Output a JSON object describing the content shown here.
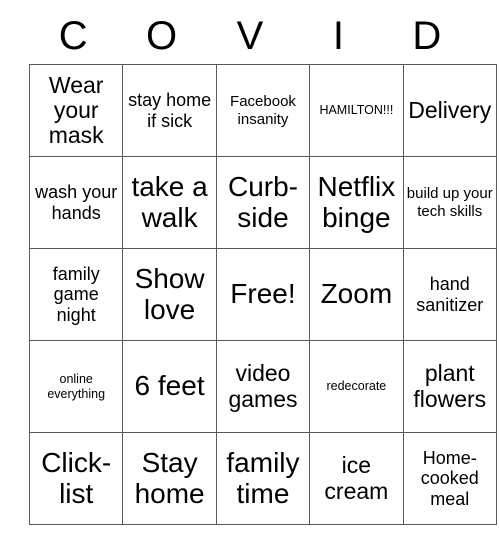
{
  "card": {
    "header_letters": [
      "C",
      "O",
      "V",
      "I",
      "D"
    ],
    "rows": [
      [
        {
          "text": "Wear your mask",
          "size": "l"
        },
        {
          "text": "stay home if sick",
          "size": "m"
        },
        {
          "text": "Facebook insanity",
          "size": "s"
        },
        {
          "text": "HAMILTON!!!",
          "size": "xs"
        },
        {
          "text": "Delivery",
          "size": "l"
        }
      ],
      [
        {
          "text": "wash your hands",
          "size": "m"
        },
        {
          "text": "take a walk",
          "size": "xl"
        },
        {
          "text": "Curb-side",
          "size": "xl"
        },
        {
          "text": "Netflix binge",
          "size": "xl"
        },
        {
          "text": "build up your tech skills",
          "size": "s"
        }
      ],
      [
        {
          "text": "family game night",
          "size": "m"
        },
        {
          "text": "Show love",
          "size": "xl"
        },
        {
          "text": "Free!",
          "size": "xl"
        },
        {
          "text": "Zoom",
          "size": "xl"
        },
        {
          "text": "hand sanitizer",
          "size": "m"
        }
      ],
      [
        {
          "text": "online everything",
          "size": "xs"
        },
        {
          "text": "6 feet",
          "size": "xl"
        },
        {
          "text": "video games",
          "size": "l"
        },
        {
          "text": "redecorate",
          "size": "xs"
        },
        {
          "text": "plant flowers",
          "size": "l"
        }
      ],
      [
        {
          "text": "Click-list",
          "size": "xl"
        },
        {
          "text": "Stay home",
          "size": "xl"
        },
        {
          "text": "family time",
          "size": "xl"
        },
        {
          "text": "ice cream",
          "size": "l"
        },
        {
          "text": "Home-cooked meal",
          "size": "m"
        }
      ]
    ]
  },
  "colors": {
    "border": "#595959",
    "text": "#000000",
    "background": "#ffffff"
  }
}
